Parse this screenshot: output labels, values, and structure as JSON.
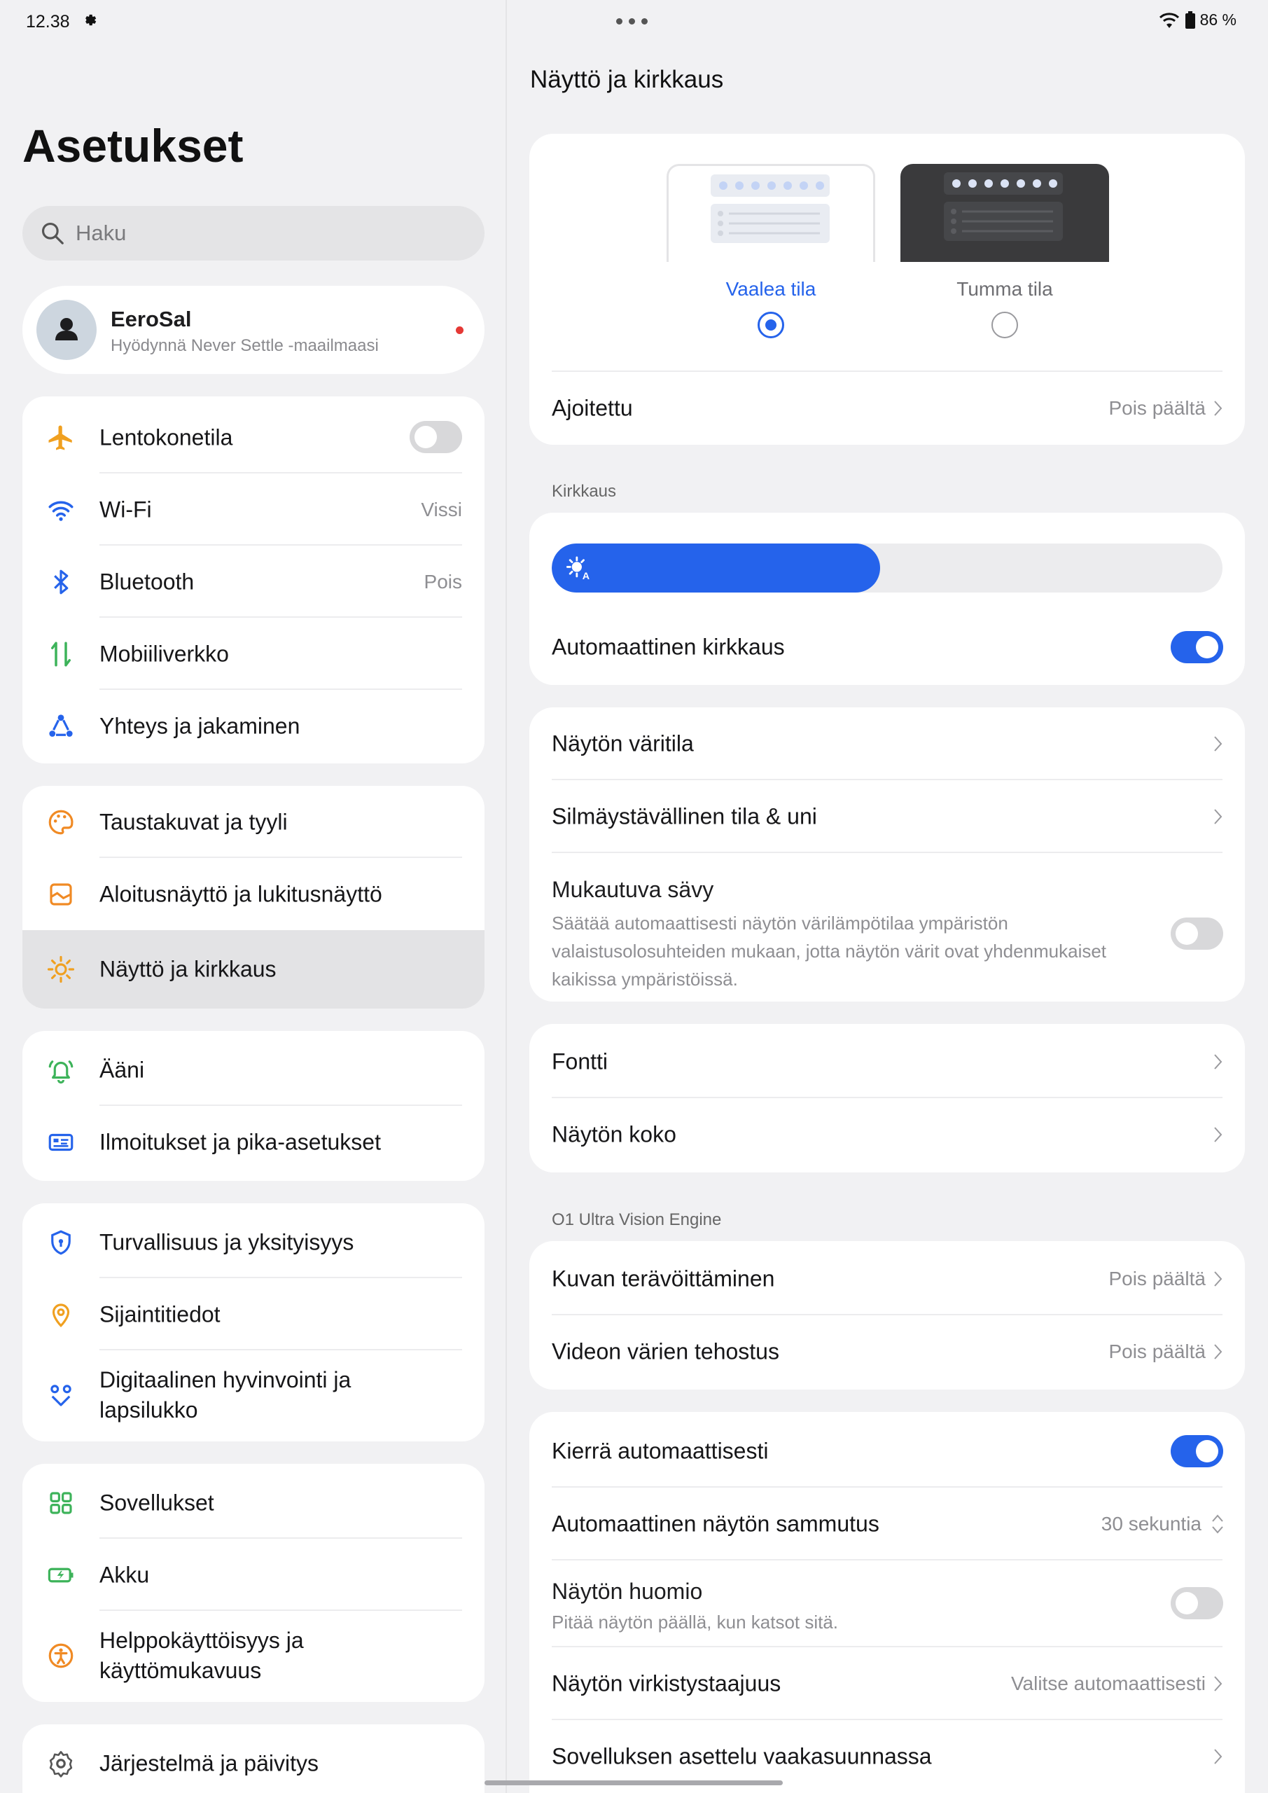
{
  "status_bar": {
    "time": "12.38",
    "battery": "86 %"
  },
  "left": {
    "title": "Asetukset",
    "search_placeholder": "Haku",
    "profile": {
      "name": "EeroSal",
      "subtitle": "Hyödynnä Never Settle -maailmaasi"
    },
    "groups": [
      {
        "items": [
          {
            "label": "Lentokonetila",
            "icon": "airplane-icon",
            "toggle": "off"
          },
          {
            "label": "Wi-Fi",
            "icon": "wifi-icon",
            "value": "Vissi"
          },
          {
            "label": "Bluetooth",
            "icon": "bluetooth-icon",
            "value": "Pois"
          },
          {
            "label": "Mobiiliverkko",
            "icon": "mobile-data-icon"
          },
          {
            "label": "Yhteys ja jakaminen",
            "icon": "share-network-icon"
          }
        ]
      },
      {
        "items": [
          {
            "label": "Taustakuvat ja tyyli",
            "icon": "palette-icon"
          },
          {
            "label": "Aloitusnäyttö ja lukitusnäyttö",
            "icon": "home-screen-icon"
          },
          {
            "label": "Näyttö ja kirkkaus",
            "icon": "sun-icon",
            "active": true
          }
        ]
      },
      {
        "items": [
          {
            "label": "Ääni",
            "icon": "bell-icon"
          },
          {
            "label": "Ilmoitukset ja pika-asetukset",
            "icon": "notification-panel-icon"
          }
        ]
      },
      {
        "items": [
          {
            "label": "Turvallisuus ja yksityisyys",
            "icon": "shield-icon"
          },
          {
            "label": "Sijaintitiedot",
            "icon": "location-pin-icon"
          },
          {
            "label": "Digitaalinen hyvinvointi ja lapsilukko",
            "icon": "wellbeing-icon"
          }
        ]
      },
      {
        "items": [
          {
            "label": "Sovellukset",
            "icon": "apps-grid-icon"
          },
          {
            "label": "Akku",
            "icon": "battery-icon"
          },
          {
            "label": "Helppokäyttöisyys ja käyttömukavuus",
            "icon": "accessibility-icon"
          }
        ]
      },
      {
        "items": [
          {
            "label": "Järjestelmä ja päivitys",
            "icon": "gear-icon"
          }
        ]
      }
    ]
  },
  "right": {
    "title": "Näyttö ja kirkkaus",
    "theme": {
      "light_label": "Vaalea tila",
      "dark_label": "Tumma tila",
      "selected": "light",
      "scheduled_label": "Ajoitettu",
      "scheduled_value": "Pois päältä"
    },
    "brightness": {
      "section_label": "Kirkkaus",
      "level": 0.49,
      "auto_label": "Automaattinen kirkkaus",
      "auto_on": true
    },
    "color": {
      "color_mode_label": "Näytön väritila",
      "eye_comfort_label": "Silmäystävällinen tila & uni",
      "adaptive_tone_label": "Mukautuva sävy",
      "adaptive_tone_desc_1": "Säätää automaattisesti näytön värilämpötilaa ympäristön",
      "adaptive_tone_desc_2": "valaistusolosuhteiden mukaan, jotta näytön värit ovat yhdenmukaiset",
      "adaptive_tone_desc_3": "kaikissa ympäristöissä.",
      "adaptive_tone_on": false
    },
    "font": {
      "font_label": "Fontti",
      "display_size_label": "Näytön koko"
    },
    "vision_engine": {
      "section_label": "O1 Ultra Vision Engine",
      "sharpening_label": "Kuvan terävöittäminen",
      "sharpening_value": "Pois päältä",
      "video_label": "Videon värien tehostus",
      "video_value": "Pois päältä"
    },
    "misc": {
      "auto_rotate_label": "Kierrä automaattisesti",
      "auto_rotate_on": true,
      "screen_timeout_label": "Automaattinen näytön sammutus",
      "screen_timeout_value": "30 sekuntia",
      "screen_attention_label": "Näytön huomio",
      "screen_attention_desc": "Pitää näytön päällä, kun katsot sitä.",
      "screen_attention_on": false,
      "refresh_rate_label": "Näytön virkistystaajuus",
      "refresh_rate_value": "Valitse automaattisesti",
      "landscape_layout_label": "Sovelluksen asettelu vaakasuunnassa"
    }
  },
  "colors": {
    "accent": "#2563eb",
    "background": "#f1f1f3",
    "card": "#ffffff"
  }
}
